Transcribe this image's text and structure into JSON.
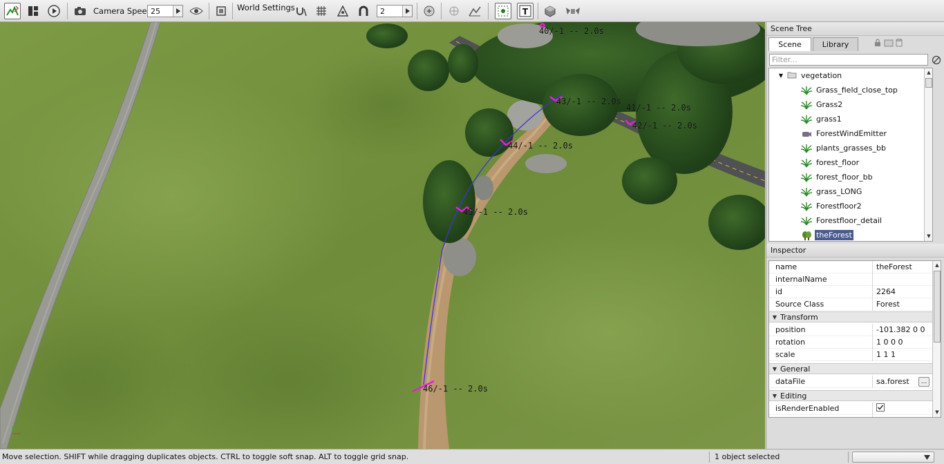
{
  "toolbar": {
    "camera_speed_label": "Camera Speed",
    "camera_speed_value": "25",
    "world_settings_label": "World Settings",
    "snap_value": "2"
  },
  "viewport": {
    "waypoint_labels": [
      "40/-1 -- 2.0s",
      "43/-1 -- 2.0s",
      "41/-1 -- 2.0s",
      "42/-1 -- 2.0s",
      "44/-1 -- 2.0s",
      "45/-1 -- 2.0s",
      "46/-1 -- 2.0s"
    ]
  },
  "scene_tree": {
    "title": "Scene Tree",
    "tabs": [
      "Scene",
      "Library"
    ],
    "filter_placeholder": "Filter...",
    "folder": "vegetation",
    "items": [
      {
        "label": "Grass_field_close_top",
        "icon": "grass-icon"
      },
      {
        "label": "Grass2",
        "icon": "grass-icon"
      },
      {
        "label": "grass1",
        "icon": "grass-icon"
      },
      {
        "label": "ForestWindEmitter",
        "icon": "wind-emitter-icon"
      },
      {
        "label": "plants_grasses_bb",
        "icon": "grass-icon"
      },
      {
        "label": "forest_floor",
        "icon": "grass-icon"
      },
      {
        "label": "forest_floor_bb",
        "icon": "grass-icon"
      },
      {
        "label": "grass_LONG",
        "icon": "grass-icon"
      },
      {
        "label": "Forestfloor2",
        "icon": "grass-icon"
      },
      {
        "label": "Forestfloor_detail",
        "icon": "grass-icon"
      },
      {
        "label": "theForest",
        "icon": "forest-icon",
        "selected": true
      }
    ]
  },
  "inspector": {
    "title": "Inspector",
    "fields": [
      {
        "name": "name",
        "value": "theForest"
      },
      {
        "name": "internalName",
        "value": ""
      },
      {
        "name": "id",
        "value": "2264"
      },
      {
        "name": "Source Class",
        "value": "Forest"
      }
    ],
    "groups": {
      "transform": "Transform",
      "general": "General",
      "editing": "Editing"
    },
    "transform_fields": [
      {
        "name": "position",
        "value": "-101.382 0 0"
      },
      {
        "name": "rotation",
        "value": "1 0 0 0"
      },
      {
        "name": "scale",
        "value": "1 1 1"
      }
    ],
    "general_fields": [
      {
        "name": "dataFile",
        "value": "sa.forest",
        "button": "..."
      }
    ],
    "editing_fields": [
      {
        "name": "isRenderEnabled",
        "checked": true
      }
    ]
  },
  "status": {
    "message": "Move selection.  SHIFT while dragging duplicates objects.  CTRL to toggle soft snap.  ALT to toggle grid snap.",
    "selection": "1 object selected",
    "dropdown_value": ""
  }
}
